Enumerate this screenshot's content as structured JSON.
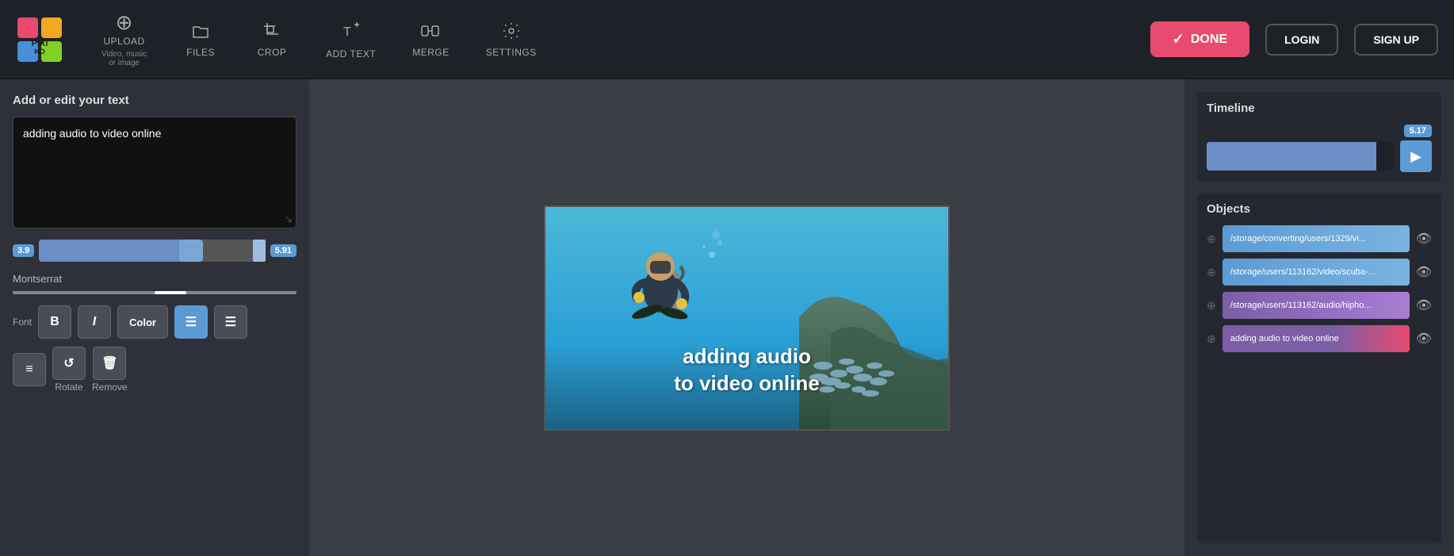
{
  "logo": {
    "alt": "Pixiko logo"
  },
  "nav": {
    "upload_label": "UPLOAD",
    "upload_sublabel": "Video, music or image",
    "files_label": "FILES",
    "crop_label": "CROP",
    "add_text_label": "ADD TEXT",
    "merge_label": "MERGE",
    "settings_label": "SETTINGS",
    "done_label": "DONE",
    "login_label": "LOGIN",
    "signup_label": "SIGN UP"
  },
  "left_panel": {
    "title": "Add or edit your text",
    "textarea_value": "adding audio to video online",
    "time_start": "3.9",
    "time_end": "5.91",
    "font_name": "Montserrat",
    "font_label": "Font",
    "bold_label": "B",
    "italic_label": "I",
    "color_label": "Color",
    "align_left_label": "≡",
    "align_center_label": "≡",
    "rotate_label": "Rotate",
    "remove_label": "Remove"
  },
  "canvas": {
    "overlay_line1": "adding audio",
    "overlay_line2": "to video online"
  },
  "right_panel": {
    "timeline_title": "Timeline",
    "time_position": "5.17",
    "objects_title": "Objects",
    "objects": [
      {
        "path": "/storage/converting/users/1329/vi...",
        "color": "blue"
      },
      {
        "path": "/storage/users/113162/video/scuba-...",
        "color": "blue"
      },
      {
        "path": "/storage/users/113162/audio/hipho...",
        "color": "purple"
      },
      {
        "path": "adding audio to video online",
        "color": "text-bar"
      }
    ]
  }
}
